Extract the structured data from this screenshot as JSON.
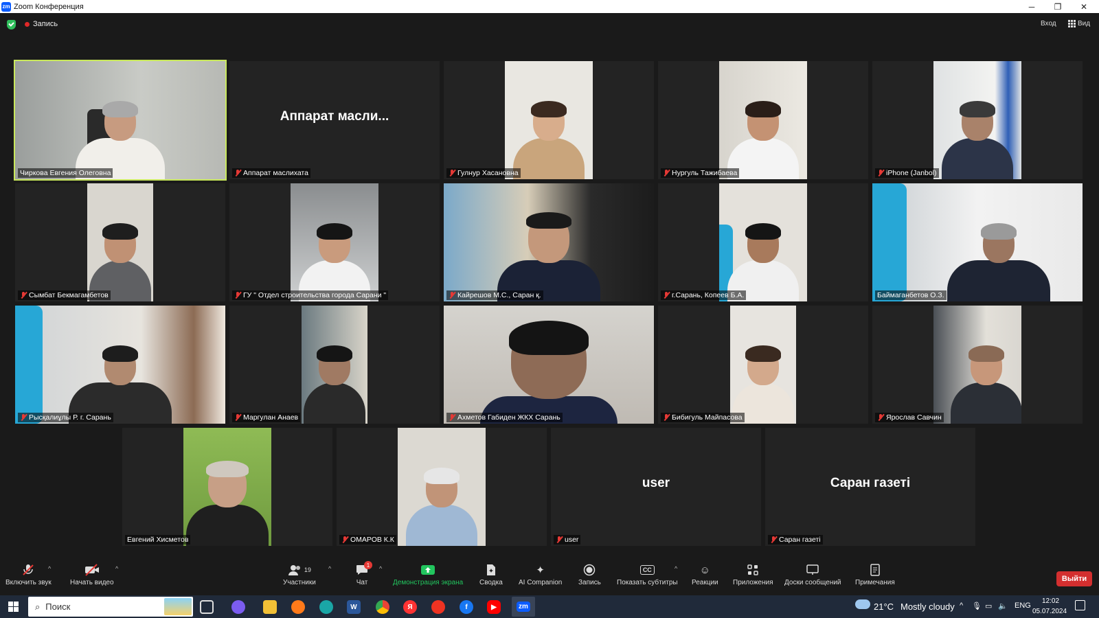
{
  "window": {
    "app_icon": "zm",
    "title": "Zoom Конференция",
    "minimize": "─",
    "restore": "❐",
    "close": "✕"
  },
  "topbar": {
    "recording": "Запись",
    "signin": "Вход",
    "view": "Вид"
  },
  "tiles": [
    {
      "label": "Чиркова Евгения Олеговна",
      "display": "",
      "muted": false
    },
    {
      "label": "Аппарат маслихата",
      "display": "Аппарат  масли...",
      "muted": true
    },
    {
      "label": "Гулнур Хасановна",
      "display": "",
      "muted": true
    },
    {
      "label": "Нургуль Тажибаева",
      "display": "",
      "muted": true
    },
    {
      "label": "iPhone (Janbol)",
      "display": "",
      "muted": true
    },
    {
      "label": "Сымбат Бекмагамбетов",
      "display": "",
      "muted": true
    },
    {
      "label": "ГУ \" Отдел строительства города Сарани \"",
      "display": "",
      "muted": true
    },
    {
      "label": "Кайрешов М.С., Саран қ.",
      "display": "",
      "muted": true
    },
    {
      "label": "г.Сарань, Копеев Б.А.",
      "display": "",
      "muted": true
    },
    {
      "label": "Баймаганбетов О.З.",
      "display": "",
      "muted": false
    },
    {
      "label": "Рысқалиұлы Р. г. Сарань",
      "display": "",
      "muted": true
    },
    {
      "label": "Маргулан Анаев",
      "display": "",
      "muted": true
    },
    {
      "label": "Ахметов Габиден ЖКХ Сарань",
      "display": "",
      "muted": true
    },
    {
      "label": "Бибигуль Майпасова",
      "display": "",
      "muted": true
    },
    {
      "label": "Ярослав Савчин",
      "display": "",
      "muted": true
    },
    {
      "label": "Евгений Хисметов",
      "display": "",
      "muted": false
    },
    {
      "label": "ОМАРОВ К.К",
      "display": "",
      "muted": true
    },
    {
      "label": "user",
      "display": "user",
      "muted": true
    },
    {
      "label": "Саран газеті",
      "display": "Саран газеті",
      "muted": true
    }
  ],
  "toolbar": {
    "unmute": "Включить звук",
    "start_video": "Начать видео",
    "participants": "Участники",
    "participants_count": "19",
    "chat": "Чат",
    "chat_badge": "1",
    "share": "Демонстрация экрана",
    "summary": "Сводка",
    "ai": "AI Companion",
    "record": "Запись",
    "captions": "Показать субтитры",
    "reactions": "Реакции",
    "apps": "Приложения",
    "whiteboards": "Доски сообщений",
    "notes": "Примечания",
    "leave": "Выйти"
  },
  "taskbar": {
    "search": "Поиск",
    "temp": "21°C",
    "weather": "Mostly cloudy",
    "lang": "ENG",
    "time": "12:02",
    "date": "05.07.2024"
  },
  "colors": {
    "active_speaker": "#c9e85c",
    "share_green": "#22c55e",
    "leave_red": "#d32f2f"
  }
}
